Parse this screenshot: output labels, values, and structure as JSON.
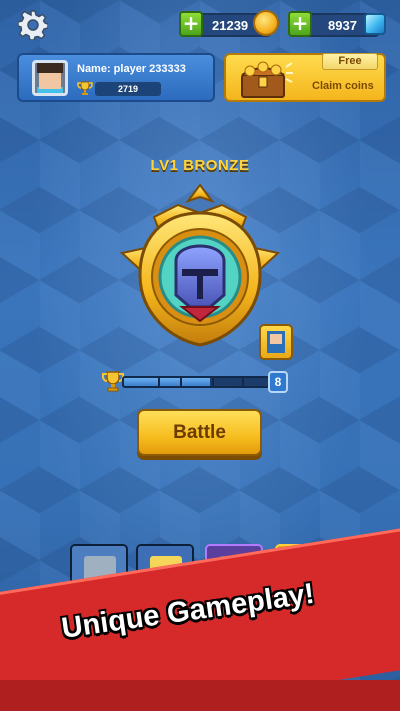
{
  "hud": {
    "coins": "21239",
    "gems": "8937",
    "icons": {
      "settings": "gear-icon",
      "add_coins": "plus-icon",
      "coin": "coin-icon",
      "add_gems": "plus-icon",
      "gem": "gem-icon"
    }
  },
  "profile": {
    "name": "Name: player 233333",
    "trophies": "2719"
  },
  "claim": {
    "tag": "Free",
    "label": "Claim coins"
  },
  "rank": {
    "title": "LV1 BRONZE",
    "next_level": "8",
    "progress_fraction": 0.6
  },
  "battle_label": "Battle",
  "cards": [
    {
      "name": "card-knight",
      "bg": "#4d7ec0",
      "head": "#9fb0c0",
      "body": "#45c0e8"
    },
    {
      "name": "card-spearman",
      "bg": "#3e6fb6",
      "head": "#f4d65a",
      "body": "#f1c23a"
    },
    {
      "name": "card-dark-knight",
      "bg": "#5b3f9c",
      "head": "#6a7fb8",
      "body": "#3d4f8a"
    },
    {
      "name": "card-golden-hero",
      "bg": "#e6a71c",
      "head": "#ffe06b",
      "body": "#f3c13b"
    }
  ],
  "banner": {
    "headline": "Unique Gameplay!"
  },
  "colors": {
    "accent_yellow": "#f6bd1f",
    "banner_red": "#d62a2a",
    "panel_blue": "#2c6bbd"
  }
}
